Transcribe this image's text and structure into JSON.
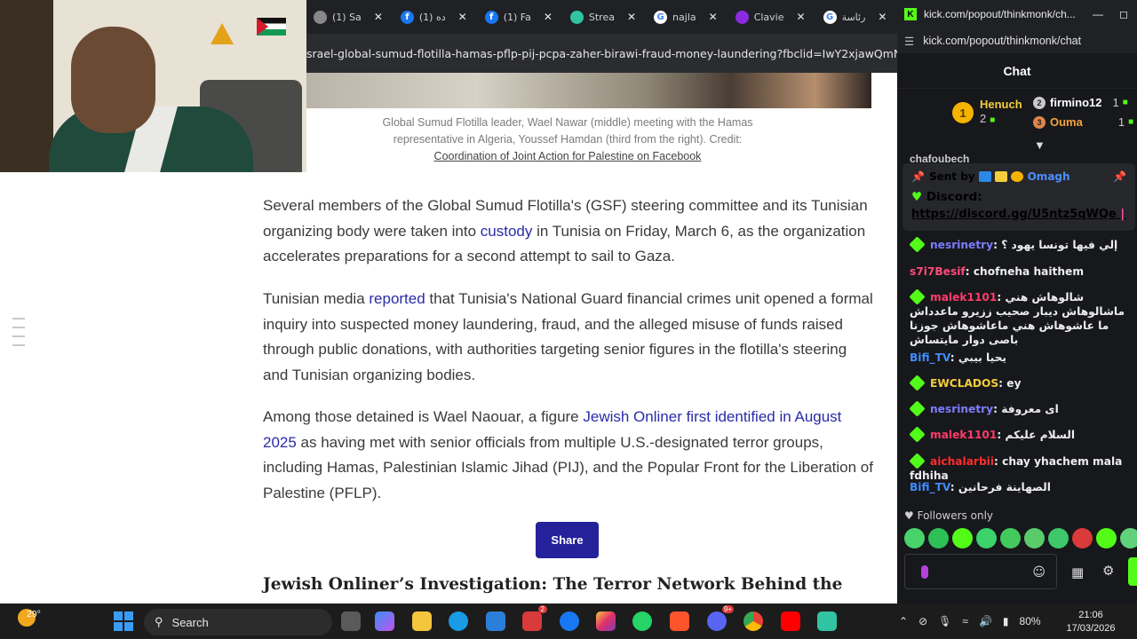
{
  "browser": {
    "tabs": [
      {
        "icon": "tab-icon-chrome-partial",
        "label": "(1) Sa",
        "color": "#888888"
      },
      {
        "icon": "facebook-icon",
        "label": "ده (1)",
        "color": "#1877f2"
      },
      {
        "icon": "facebook-icon",
        "label": "(1) Fa",
        "color": "#1877f2"
      },
      {
        "icon": "streamlabs-icon",
        "label": "Strea",
        "color": "#31c3a2"
      },
      {
        "icon": "google-icon",
        "label": "najla",
        "color": "#ffffff"
      },
      {
        "icon": "claude-icon",
        "label": "Clavie",
        "color": "#8a2be2"
      },
      {
        "icon": "google-icon",
        "label": "رئاسة",
        "color": "#ffffff"
      }
    ],
    "url": "srael-global-sumud-flotilla-hamas-pflp-pij-pcpa-zaher-birawi-fraud-money-laundering?fbclid=IwY2xjawQmNzNlel"
  },
  "article": {
    "caption": "Global Sumud Flotilla leader, Wael Nawar (middle) meeting with the Hamas representative in Algeria, Youssef Hamdan (third from the right). Credit:",
    "caption_credit": "Coordination of Joint Action for Palestine on Facebook",
    "p1": {
      "before": "Several members of the Global Sumud Flotilla's (GSF) steering committee and its Tunisian organizing body were taken into ",
      "link": "custody",
      "after": " in Tunisia on Friday, March 6, as the organization accelerates preparations for a second attempt to sail to Gaza."
    },
    "p2": {
      "before": "Tunisian media ",
      "link": "reported",
      "after": " that Tunisia's National Guard financial crimes unit opened a formal inquiry into suspected money laundering, fraud, and the alleged misuse of funds raised through public donations, with authorities targeting senior figures in the flotilla's steering and Tunisian organizing bodies."
    },
    "p3": {
      "before": "Among those detained is Wael Naouar, a figure ",
      "link": "Jewish Onliner first identified in August 2025",
      "after": " as having met with senior officials from multiple U.S.-designated terror groups, including Hamas, Palestinian Islamic Jihad (PIJ), and the Popular Front for the Liberation of Palestine (PFLP)."
    },
    "share_label": "Share",
    "heading": "Jewish Onliner’s Investigation: The Terror Network Behind the"
  },
  "kick": {
    "window_title": "kick.com/popout/thinkmonk/ch...",
    "url": "kick.com/popout/thinkmonk/chat",
    "chat_title": "Chat",
    "leaderboard": [
      {
        "rank": "1",
        "name": "Henuch",
        "count": "2"
      },
      {
        "rank": "2",
        "name": "firmino12",
        "count": "1"
      },
      {
        "rank": "3",
        "name": "Ouma",
        "count": "1"
      }
    ],
    "pinned": {
      "sent_by": "Sent by",
      "user": "Omagh",
      "discord_label": "Discord:",
      "discord_link": "https://discord.gg/U5ntz5qWQe",
      "after_link": "| ❤ ..."
    },
    "messages": [
      {
        "user": "nesrinetry",
        "color": "#7c7cff",
        "text": "إلي فيها تونسا يهود ؟",
        "gem": true
      },
      {
        "user": "s7i7Besif",
        "color": "#ff4b78",
        "text": "chofneha haithem",
        "gem": false
      },
      {
        "user": "malek1101",
        "color": "#ff3b6b",
        "text": "شالوهاش هني ماشالوهاش ديبار صحيب ززيرو ماعدداش ما عاشوهاش هني ماعاشوهاش جوزنا باصى دوار مايتساش",
        "gem": true
      },
      {
        "user": "Bifi_TV",
        "color": "#3f8cff",
        "text": "يحيا بيبي",
        "gem": false
      },
      {
        "user": "EWCLADOS",
        "color": "#f3cd3b",
        "text": "ey",
        "gem": true
      },
      {
        "user": "nesrinetry",
        "color": "#7c7cff",
        "text": "اى معروفة",
        "gem": true
      },
      {
        "user": "malek1101",
        "color": "#ff3b6b",
        "text": "السلام عليكم",
        "gem": true
      },
      {
        "user": "aichalarbii",
        "color": "#ff2d2d",
        "text": "chay yhachem mala fdhiha",
        "gem": true
      },
      {
        "user": "Bifi_TV",
        "color": "#3f8cff",
        "text": "الصهاينة فرحانين",
        "gem": false
      }
    ],
    "partial_user": "chafoubech",
    "followers_only": "Followers only"
  },
  "taskbar": {
    "weather": "29°",
    "search_label": "Search",
    "mail_badge": "2",
    "discord_badge": "9+",
    "battery": "80%",
    "time": "21:06",
    "date": "17/03/2026"
  }
}
